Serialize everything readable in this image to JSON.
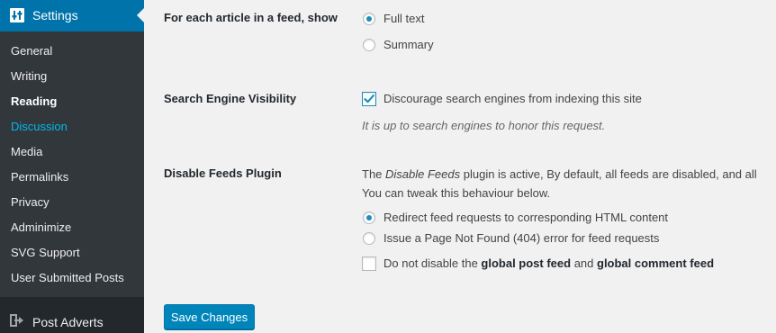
{
  "sidebar": {
    "header": {
      "label": "Settings",
      "icon": "settings-sliders-icon"
    },
    "items": [
      {
        "label": "General"
      },
      {
        "label": "Writing"
      },
      {
        "label": "Reading"
      },
      {
        "label": "Discussion"
      },
      {
        "label": "Media"
      },
      {
        "label": "Permalinks"
      },
      {
        "label": "Privacy"
      },
      {
        "label": "Adminimize"
      },
      {
        "label": "SVG Support"
      },
      {
        "label": "User Submitted Posts"
      }
    ],
    "current": "Reading",
    "hovered": "Discussion",
    "next_menu": {
      "label": "Post Adverts",
      "icon": "sign-in-arrow-icon"
    }
  },
  "feed_article": {
    "label": "For each article in a feed, show",
    "options": [
      {
        "label": "Full text",
        "checked": true
      },
      {
        "label": "Summary",
        "checked": false
      }
    ]
  },
  "search_visibility": {
    "label": "Search Engine Visibility",
    "checkbox_label": "Discourage search engines from indexing this site",
    "checked": true,
    "description": "It is up to search engines to honor this request."
  },
  "disable_feeds": {
    "label": "Disable Feeds Plugin",
    "desc_prefix": "The ",
    "desc_plugin": "Disable Feeds",
    "desc_suffix": " plugin is active, By default, all feeds are disabled, and all",
    "desc_line2": "You can tweak this behaviour below.",
    "options": [
      {
        "label": "Redirect feed requests to corresponding HTML content",
        "checked": true
      },
      {
        "label": "Issue a Page Not Found (404) error for feed requests",
        "checked": false
      }
    ],
    "global_checkbox": {
      "prefix": "Do not disable the ",
      "bold1": "global post feed",
      "mid": " and ",
      "bold2": "global comment feed",
      "checked": false
    }
  },
  "save_button": {
    "label": "Save Changes"
  },
  "colors": {
    "sidebar_bg": "#23282d",
    "submenu_bg": "#32373c",
    "active_blue": "#0073aa",
    "link_hover": "#00b9eb",
    "button_blue": "#0085ba",
    "page_bg": "#f1f1f1"
  }
}
